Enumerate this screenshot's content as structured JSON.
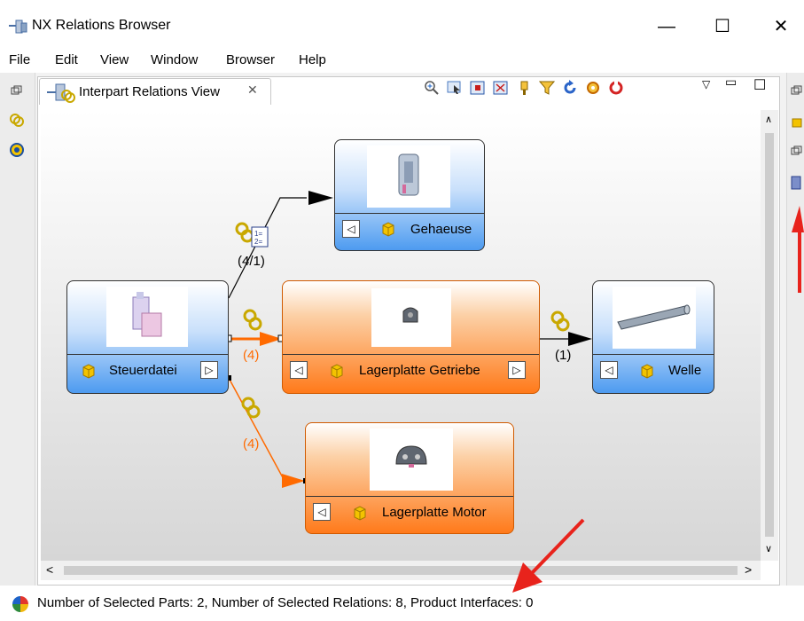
{
  "window": {
    "title": "NX Relations Browser"
  },
  "menu": {
    "items": [
      "File",
      "Edit",
      "View",
      "Window",
      "Browser",
      "Help"
    ]
  },
  "view_tab": {
    "label": "Interpart Relations View"
  },
  "toolbar": {
    "icons": [
      "zoom-in-icon",
      "select-icon",
      "fit-icon",
      "zoom-box-icon",
      "paint-icon",
      "filter-icon",
      "refresh-icon",
      "settings-icon",
      "reset-icon"
    ]
  },
  "nodes": {
    "gehaeuse": {
      "label": "Gehaeuse",
      "color": "#4d9bf0"
    },
    "steuerdatei": {
      "label": "Steuerdatei",
      "color": "#4d9bf0"
    },
    "lagerplatte_getriebe": {
      "label": "Lagerplatte Getriebe",
      "color": "#ff7a1a"
    },
    "welle": {
      "label": "Welle",
      "color": "#4d9bf0"
    },
    "lagerplatte_motor": {
      "label": "Lagerplatte Motor",
      "color": "#ff7a1a"
    }
  },
  "edges": {
    "to_gehaeuse": "(4/1)",
    "to_getriebe": "(4)",
    "to_welle": "(1)",
    "to_motor": "(4)"
  },
  "status": {
    "text": "Number of Selected Parts: 2, Number of Selected Relations: 8, Product Interfaces: 0"
  },
  "colors": {
    "accent_orange": "#ff6a00",
    "annotation_red": "#e8231c"
  }
}
